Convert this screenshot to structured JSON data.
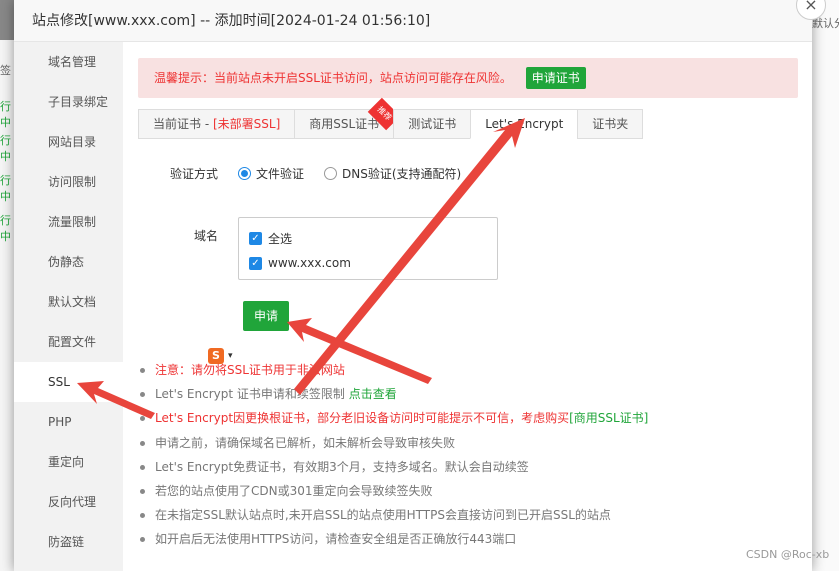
{
  "background": {
    "left_labels": [
      "行中",
      "行中",
      "行中",
      "行中"
    ],
    "left_top": "签",
    "right_text": "默认分"
  },
  "dialog": {
    "title": "站点修改[www.xxx.com] -- 添加时间[2024-01-24 01:56:10]",
    "close_icon": "×"
  },
  "sidebar": {
    "items": [
      {
        "label": "域名管理"
      },
      {
        "label": "子目录绑定"
      },
      {
        "label": "网站目录"
      },
      {
        "label": "访问限制"
      },
      {
        "label": "流量限制"
      },
      {
        "label": "伪静态"
      },
      {
        "label": "默认文档"
      },
      {
        "label": "配置文件"
      },
      {
        "label": "SSL"
      },
      {
        "label": "PHP"
      },
      {
        "label": "重定向"
      },
      {
        "label": "反向代理"
      },
      {
        "label": "防盗链"
      }
    ]
  },
  "warning": {
    "text": "温馨提示：当前站点未开启SSL证书访问，站点访问可能存在风险。",
    "button": "申请证书"
  },
  "tabs": {
    "current_prefix": "当前证书 - ",
    "current_status": "[未部署SSL]",
    "commercial": "商用SSL证书",
    "recommend_badge": "推荐",
    "test": "测试证书",
    "letsencrypt": "Let's Encrypt",
    "folder": "证书夹"
  },
  "form": {
    "verify_label": "验证方式",
    "radio_file": "文件验证",
    "radio_dns": "DNS验证(支持通配符)",
    "domain_label": "域名",
    "check_all": "全选",
    "check_domain": "www.xxx.com",
    "apply_button": "申请"
  },
  "ime": {
    "icon": "S",
    "caret": "▾"
  },
  "notes": {
    "n1": "注意：请勿将SSL证书用于非法网站",
    "n2_prefix": "Let's Encrypt 证书申请和续签限制 ",
    "n2_link": "点击查看",
    "n3_prefix": "Let's Encrypt因更换根证书，部分老旧设备访问时可能提示不可信，考虑购买",
    "n3_link": "[商用SSL证书]",
    "n4": "申请之前，请确保域名已解析，如未解析会导致审核失败",
    "n5": "Let's Encrypt免费证书，有效期3个月，支持多域名。默认会自动续签",
    "n6": "若您的站点使用了CDN或301重定向会导致续签失败",
    "n7": "在未指定SSL默认站点时,未开启SSL的站点使用HTTPS会直接访问到已开启SSL的站点",
    "n8": "如开启后无法使用HTTPS访问，请检查安全组是否正确放行443端口"
  },
  "watermark": "CSDN @Roc-xb",
  "colors": {
    "accent": "#20a53a",
    "danger": "#e33333",
    "arrow": "#e8453c"
  }
}
